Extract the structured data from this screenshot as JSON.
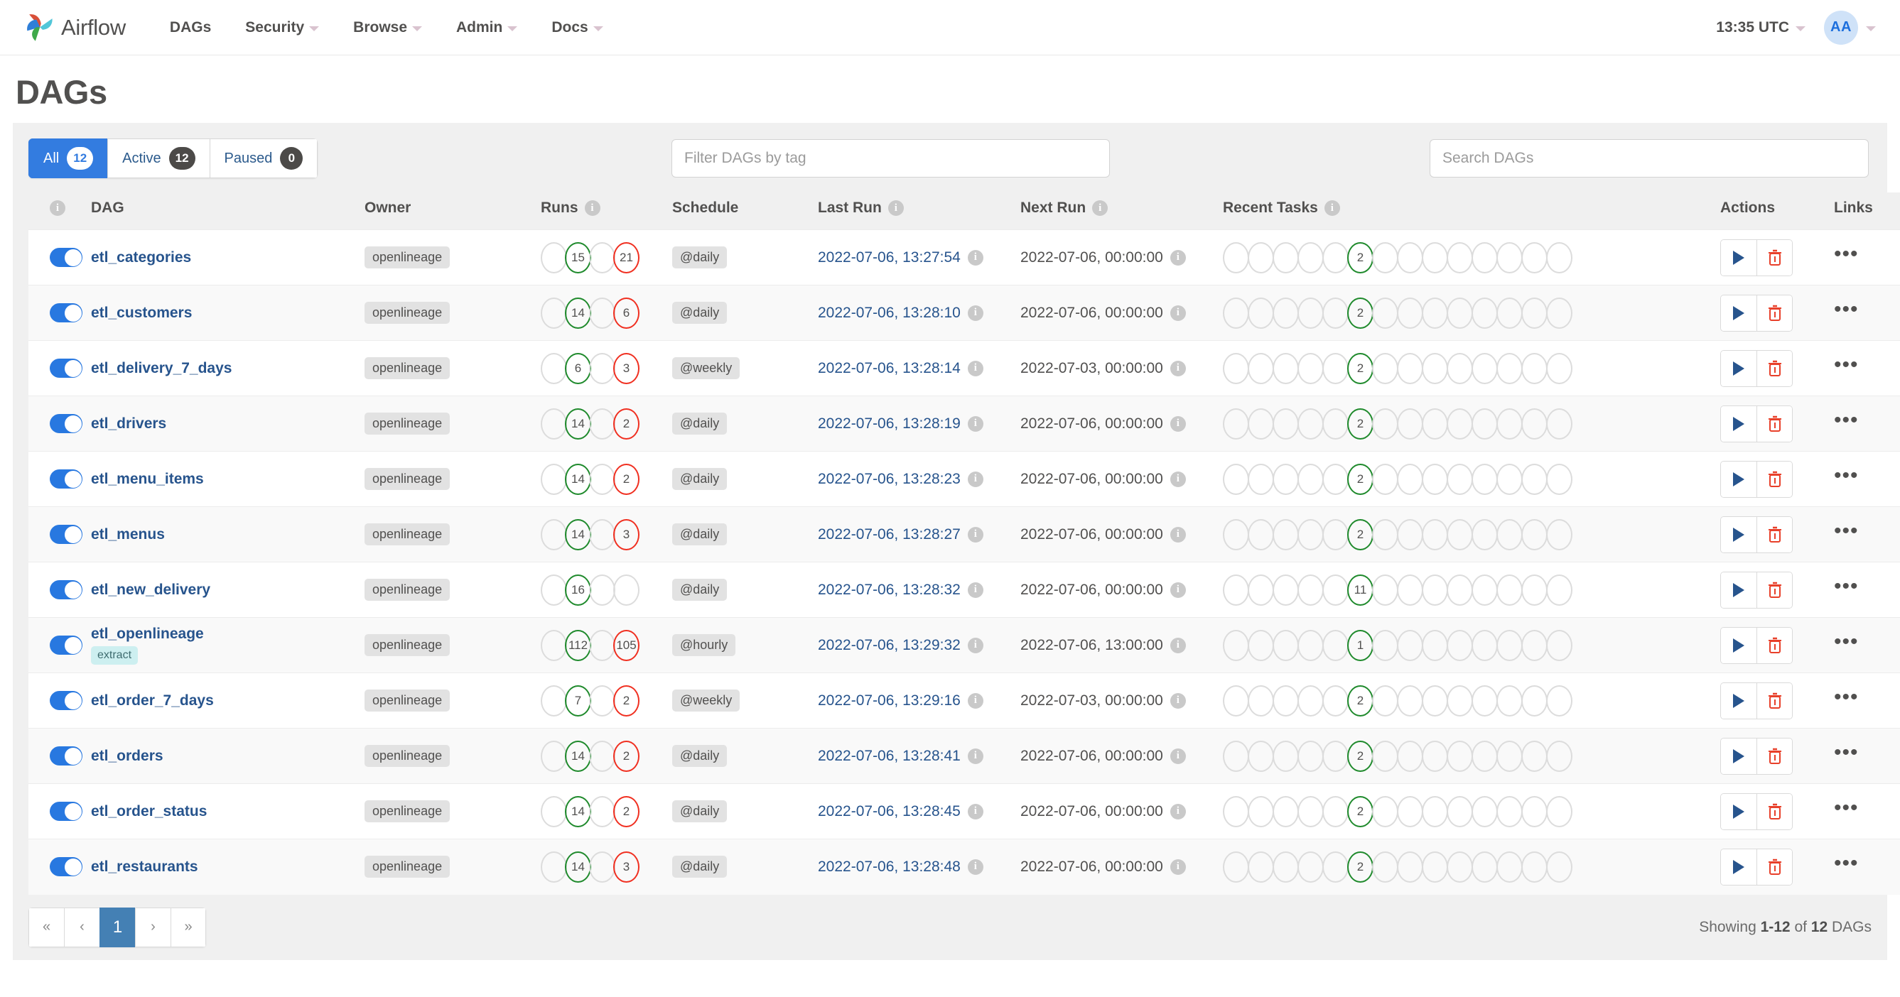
{
  "navbar": {
    "brand": "Airflow",
    "items": [
      {
        "label": "DAGs",
        "has_caret": false
      },
      {
        "label": "Security",
        "has_caret": true
      },
      {
        "label": "Browse",
        "has_caret": true
      },
      {
        "label": "Admin",
        "has_caret": true
      },
      {
        "label": "Docs",
        "has_caret": true
      }
    ],
    "clock": "13:35 UTC",
    "avatar_initials": "AA"
  },
  "page": {
    "title": "DAGs"
  },
  "filters": {
    "tabs": [
      {
        "label": "All",
        "count": "12",
        "active": true
      },
      {
        "label": "Active",
        "count": "12",
        "active": false
      },
      {
        "label": "Paused",
        "count": "0",
        "active": false
      }
    ],
    "tag_placeholder": "Filter DAGs by tag",
    "tag_value": "",
    "search_placeholder": "Search DAGs",
    "search_value": ""
  },
  "table": {
    "headers": {
      "toggle": "",
      "dag": "DAG",
      "owner": "Owner",
      "runs": "Runs",
      "schedule": "Schedule",
      "last_run": "Last Run",
      "next_run": "Next Run",
      "recent_tasks": "Recent Tasks",
      "actions": "Actions",
      "links": "Links"
    },
    "recent_tasks_slots": 14,
    "rows": [
      {
        "paused": false,
        "name": "etl_categories",
        "tags": [],
        "owner": "openlineage",
        "runs": [
          {
            "value": "",
            "state": "none"
          },
          {
            "value": "15",
            "state": "success"
          },
          {
            "value": "",
            "state": "none"
          },
          {
            "value": "21",
            "state": "failed"
          }
        ],
        "schedule": "@daily",
        "last_run": "2022-07-06, 13:27:54",
        "next_run": "2022-07-06, 00:00:00",
        "recent_tasks": [
          {
            "index": 5,
            "value": "2",
            "state": "success"
          }
        ]
      },
      {
        "paused": false,
        "name": "etl_customers",
        "tags": [],
        "owner": "openlineage",
        "runs": [
          {
            "value": "",
            "state": "none"
          },
          {
            "value": "14",
            "state": "success"
          },
          {
            "value": "",
            "state": "none"
          },
          {
            "value": "6",
            "state": "failed"
          }
        ],
        "schedule": "@daily",
        "last_run": "2022-07-06, 13:28:10",
        "next_run": "2022-07-06, 00:00:00",
        "recent_tasks": [
          {
            "index": 5,
            "value": "2",
            "state": "success"
          }
        ]
      },
      {
        "paused": false,
        "name": "etl_delivery_7_days",
        "tags": [],
        "owner": "openlineage",
        "runs": [
          {
            "value": "",
            "state": "none"
          },
          {
            "value": "6",
            "state": "success"
          },
          {
            "value": "",
            "state": "none"
          },
          {
            "value": "3",
            "state": "failed"
          }
        ],
        "schedule": "@weekly",
        "last_run": "2022-07-06, 13:28:14",
        "next_run": "2022-07-03, 00:00:00",
        "recent_tasks": [
          {
            "index": 5,
            "value": "2",
            "state": "success"
          }
        ]
      },
      {
        "paused": false,
        "name": "etl_drivers",
        "tags": [],
        "owner": "openlineage",
        "runs": [
          {
            "value": "",
            "state": "none"
          },
          {
            "value": "14",
            "state": "success"
          },
          {
            "value": "",
            "state": "none"
          },
          {
            "value": "2",
            "state": "failed"
          }
        ],
        "schedule": "@daily",
        "last_run": "2022-07-06, 13:28:19",
        "next_run": "2022-07-06, 00:00:00",
        "recent_tasks": [
          {
            "index": 5,
            "value": "2",
            "state": "success"
          }
        ]
      },
      {
        "paused": false,
        "name": "etl_menu_items",
        "tags": [],
        "owner": "openlineage",
        "runs": [
          {
            "value": "",
            "state": "none"
          },
          {
            "value": "14",
            "state": "success"
          },
          {
            "value": "",
            "state": "none"
          },
          {
            "value": "2",
            "state": "failed"
          }
        ],
        "schedule": "@daily",
        "last_run": "2022-07-06, 13:28:23",
        "next_run": "2022-07-06, 00:00:00",
        "recent_tasks": [
          {
            "index": 5,
            "value": "2",
            "state": "success"
          }
        ]
      },
      {
        "paused": false,
        "name": "etl_menus",
        "tags": [],
        "owner": "openlineage",
        "runs": [
          {
            "value": "",
            "state": "none"
          },
          {
            "value": "14",
            "state": "success"
          },
          {
            "value": "",
            "state": "none"
          },
          {
            "value": "3",
            "state": "failed"
          }
        ],
        "schedule": "@daily",
        "last_run": "2022-07-06, 13:28:27",
        "next_run": "2022-07-06, 00:00:00",
        "recent_tasks": [
          {
            "index": 5,
            "value": "2",
            "state": "success"
          }
        ]
      },
      {
        "paused": false,
        "name": "etl_new_delivery",
        "tags": [],
        "owner": "openlineage",
        "runs": [
          {
            "value": "",
            "state": "none"
          },
          {
            "value": "16",
            "state": "success"
          },
          {
            "value": "",
            "state": "none"
          },
          {
            "value": "",
            "state": "none"
          }
        ],
        "schedule": "@daily",
        "last_run": "2022-07-06, 13:28:32",
        "next_run": "2022-07-06, 00:00:00",
        "recent_tasks": [
          {
            "index": 5,
            "value": "11",
            "state": "success"
          }
        ]
      },
      {
        "paused": false,
        "name": "etl_openlineage",
        "tags": [
          "extract"
        ],
        "owner": "openlineage",
        "runs": [
          {
            "value": "",
            "state": "none"
          },
          {
            "value": "112",
            "state": "success"
          },
          {
            "value": "",
            "state": "none"
          },
          {
            "value": "105",
            "state": "failed"
          }
        ],
        "schedule": "@hourly",
        "last_run": "2022-07-06, 13:29:32",
        "next_run": "2022-07-06, 13:00:00",
        "recent_tasks": [
          {
            "index": 5,
            "value": "1",
            "state": "success"
          }
        ]
      },
      {
        "paused": false,
        "name": "etl_order_7_days",
        "tags": [],
        "owner": "openlineage",
        "runs": [
          {
            "value": "",
            "state": "none"
          },
          {
            "value": "7",
            "state": "success"
          },
          {
            "value": "",
            "state": "none"
          },
          {
            "value": "2",
            "state": "failed"
          }
        ],
        "schedule": "@weekly",
        "last_run": "2022-07-06, 13:29:16",
        "next_run": "2022-07-03, 00:00:00",
        "recent_tasks": [
          {
            "index": 5,
            "value": "2",
            "state": "success"
          }
        ]
      },
      {
        "paused": false,
        "name": "etl_orders",
        "tags": [],
        "owner": "openlineage",
        "runs": [
          {
            "value": "",
            "state": "none"
          },
          {
            "value": "14",
            "state": "success"
          },
          {
            "value": "",
            "state": "none"
          },
          {
            "value": "2",
            "state": "failed"
          }
        ],
        "schedule": "@daily",
        "last_run": "2022-07-06, 13:28:41",
        "next_run": "2022-07-06, 00:00:00",
        "recent_tasks": [
          {
            "index": 5,
            "value": "2",
            "state": "success"
          }
        ]
      },
      {
        "paused": false,
        "name": "etl_order_status",
        "tags": [],
        "owner": "openlineage",
        "runs": [
          {
            "value": "",
            "state": "none"
          },
          {
            "value": "14",
            "state": "success"
          },
          {
            "value": "",
            "state": "none"
          },
          {
            "value": "2",
            "state": "failed"
          }
        ],
        "schedule": "@daily",
        "last_run": "2022-07-06, 13:28:45",
        "next_run": "2022-07-06, 00:00:00",
        "recent_tasks": [
          {
            "index": 5,
            "value": "2",
            "state": "success"
          }
        ]
      },
      {
        "paused": false,
        "name": "etl_restaurants",
        "tags": [],
        "owner": "openlineage",
        "runs": [
          {
            "value": "",
            "state": "none"
          },
          {
            "value": "14",
            "state": "success"
          },
          {
            "value": "",
            "state": "none"
          },
          {
            "value": "3",
            "state": "failed"
          }
        ],
        "schedule": "@daily",
        "last_run": "2022-07-06, 13:28:48",
        "next_run": "2022-07-06, 00:00:00",
        "recent_tasks": [
          {
            "index": 5,
            "value": "2",
            "state": "success"
          }
        ]
      }
    ]
  },
  "footer": {
    "pager": [
      "«",
      "‹",
      "1",
      "›",
      "»"
    ],
    "current_page": "1",
    "showing_prefix": "Showing ",
    "showing_range": "1-12",
    "showing_mid": " of ",
    "showing_total": "12",
    "showing_suffix": " DAGs"
  },
  "colors": {
    "accent": "#337ce0",
    "success": "#1f8a2c",
    "failed": "#f02f20",
    "link": "#27548d",
    "panel": "#f0f0f0"
  }
}
